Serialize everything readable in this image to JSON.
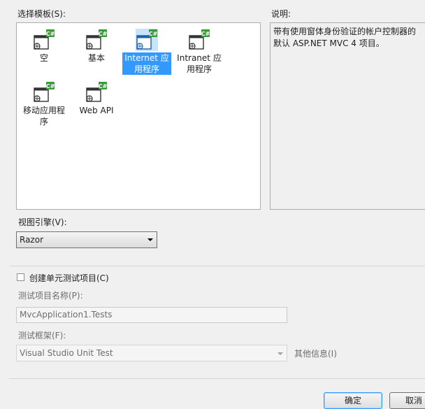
{
  "templates_section": {
    "label": "选择模板(S):",
    "items": [
      {
        "label": "空",
        "selected": false,
        "icon": "mvc-project-icon"
      },
      {
        "label": "基本",
        "selected": false,
        "icon": "mvc-project-icon"
      },
      {
        "label": "Internet 应用程序",
        "selected": true,
        "icon": "mvc-project-icon"
      },
      {
        "label": "Intranet 应用程序",
        "selected": false,
        "icon": "mvc-project-icon"
      },
      {
        "label": "移动应用程序",
        "selected": false,
        "icon": "mvc-project-icon"
      },
      {
        "label": "Web API",
        "selected": false,
        "icon": "mvc-project-icon"
      }
    ]
  },
  "description_section": {
    "label": "说明:",
    "text": "带有使用窗体身份验证的帐户控制器的默认 ASP.NET MVC 4 项目。"
  },
  "view_engine": {
    "label": "视图引擎(V):",
    "value": "Razor"
  },
  "unit_test": {
    "checkbox_label": "创建单元测试项目(C)",
    "checked": false,
    "project_name_label": "测试项目名称(P):",
    "project_name_value": "MvcApplication1.Tests",
    "framework_label": "测试框架(F):",
    "framework_value": "Visual Studio Unit Test",
    "more_info_label": "其他信息(I)"
  },
  "buttons": {
    "ok_label": "确定",
    "cancel_label": "取消"
  },
  "colors": {
    "selection": "#3399ff",
    "csharp_badge": "#3a9a3a",
    "dialog_bg": "#f0f0f0"
  }
}
